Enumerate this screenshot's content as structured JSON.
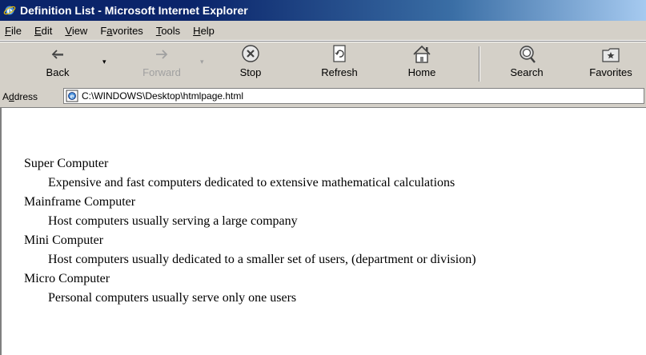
{
  "window": {
    "title": "Definition List - Microsoft Internet Explorer"
  },
  "menu": {
    "items": [
      {
        "mnemonic": "F",
        "rest": "ile"
      },
      {
        "mnemonic": "E",
        "rest": "dit"
      },
      {
        "mnemonic": "V",
        "rest": "iew"
      },
      {
        "pre": "F",
        "mnemonic": "a",
        "rest": "vorites"
      },
      {
        "mnemonic": "T",
        "rest": "ools"
      },
      {
        "mnemonic": "H",
        "rest": "elp"
      }
    ]
  },
  "toolbar": {
    "back_label": "Back",
    "forward_label": "Forward",
    "stop_label": "Stop",
    "refresh_label": "Refresh",
    "home_label": "Home",
    "search_label": "Search",
    "favorites_label": "Favorites",
    "forward_disabled": true,
    "icons": {
      "back": "back-arrow-icon",
      "forward": "forward-arrow-icon",
      "stop": "stop-icon",
      "refresh": "refresh-icon",
      "home": "home-icon",
      "search": "search-icon",
      "favorites": "favorites-icon"
    }
  },
  "address": {
    "label_pre": "A",
    "label_mnemonic": "d",
    "label_rest": "dress",
    "value": "C:\\WINDOWS\\Desktop\\htmlpage.html"
  },
  "definitions": [
    {
      "term": "Super Computer",
      "description": "Expensive and fast computers dedicated to extensive mathematical calculations"
    },
    {
      "term": "Mainframe Computer",
      "description": "Host computers usually serving a large company"
    },
    {
      "term": "Mini Computer",
      "description": "Host computers usually dedicated to a smaller set of users, (department or division)"
    },
    {
      "term": "Micro Computer",
      "description": "Personal computers usually serve only one users"
    }
  ],
  "colors": {
    "titlebar_start": "#0a246a",
    "titlebar_end": "#a6caf0",
    "chrome": "#d4d0c8",
    "content_bg": "#ffffff"
  }
}
